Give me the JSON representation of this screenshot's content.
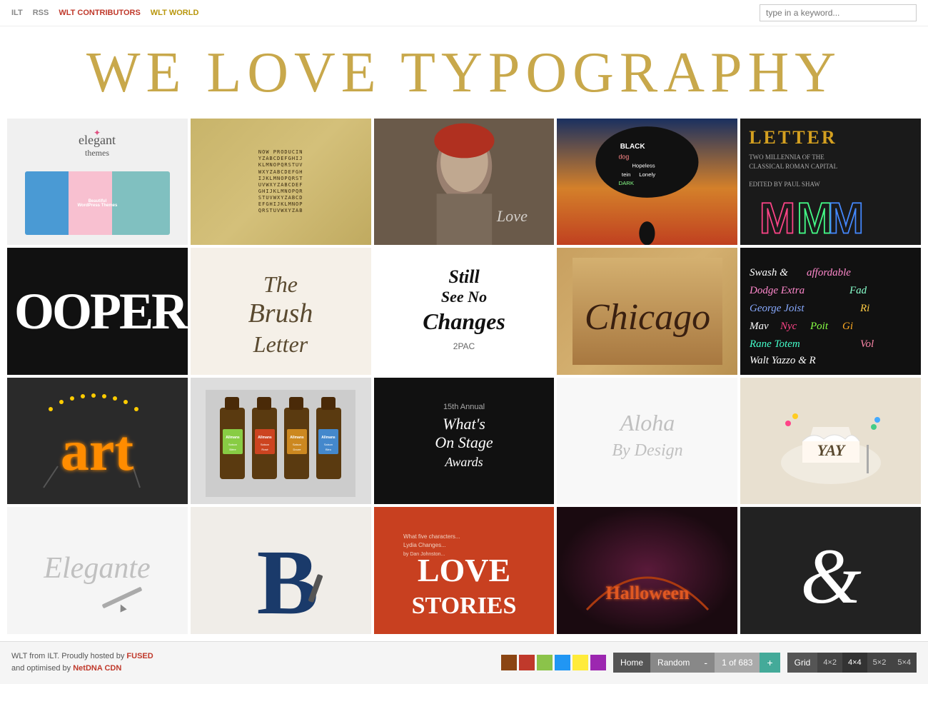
{
  "nav": {
    "links": [
      {
        "label": "ILT",
        "style": "gray",
        "id": "ilt"
      },
      {
        "label": "RSS",
        "style": "gray",
        "id": "rss"
      },
      {
        "label": "WLT CONTRIBUTORS",
        "style": "red",
        "id": "contributors"
      },
      {
        "label": "WLT WORLD",
        "style": "gray",
        "id": "world"
      }
    ],
    "search_placeholder": "type in a keyword..."
  },
  "site_title": "WE LOVE TYPOGRAPHY",
  "grid": {
    "cells": [
      {
        "id": "elegant-themes",
        "type": "elegant",
        "alt": "Elegant Themes"
      },
      {
        "id": "alphabet-grid",
        "type": "alphabet",
        "alt": "Alphabet Typography Grid"
      },
      {
        "id": "portrait-love",
        "type": "portrait",
        "alt": "Portrait with Love text"
      },
      {
        "id": "black-dog",
        "type": "blackdog",
        "alt": "Black Dog typography"
      },
      {
        "id": "letter-book",
        "type": "letterbook",
        "alt": "Letter Two Millennia book"
      },
      {
        "id": "cooper",
        "type": "cooper",
        "alt": "Cooper typeface"
      },
      {
        "id": "brush-letter",
        "type": "brush",
        "alt": "The Brush Letter"
      },
      {
        "id": "still-no-changes",
        "type": "still",
        "alt": "Still See No Changes"
      },
      {
        "id": "chicago",
        "type": "chicago",
        "alt": "Chicago lettering"
      },
      {
        "id": "swash",
        "type": "swash",
        "alt": "Swash typography"
      },
      {
        "id": "art-sign",
        "type": "art",
        "alt": "Art marquee sign"
      },
      {
        "id": "beer-bottles",
        "type": "beer",
        "alt": "Beer bottles typography"
      },
      {
        "id": "whats-on-stage",
        "type": "stage",
        "alt": "What's On Stage Awards"
      },
      {
        "id": "aloha-design",
        "type": "aloha",
        "alt": "Aloha By Design"
      },
      {
        "id": "yay-cake",
        "type": "yay",
        "alt": "YAY cake"
      },
      {
        "id": "elegante-script",
        "type": "elegante",
        "alt": "Elegante script"
      },
      {
        "id": "b-letter",
        "type": "bletter",
        "alt": "B letter"
      },
      {
        "id": "love-stories",
        "type": "love",
        "alt": "Love Stories"
      },
      {
        "id": "halloween",
        "type": "halloween",
        "alt": "Halloween typography"
      },
      {
        "id": "ampersand",
        "type": "ampersand",
        "alt": "Ampersand"
      }
    ]
  },
  "footer": {
    "credit": "WLT from ILT. Proudly hosted by",
    "hosted_by": "FUSED",
    "optimised": "and optimised by",
    "cdn": "NetDNA CDN",
    "swatches": [
      "#8B4513",
      "#C0392B",
      "#8BC34A",
      "#2196F3",
      "#FFEB3B",
      "#9C27B0"
    ],
    "pagination": {
      "home": "Home",
      "random": "Random",
      "minus": "-",
      "page_info": "1 of 683",
      "plus": "+"
    },
    "grid_options": {
      "label": "Grid",
      "options": [
        "4×2",
        "4×4",
        "5×2",
        "5×4"
      ]
    }
  }
}
